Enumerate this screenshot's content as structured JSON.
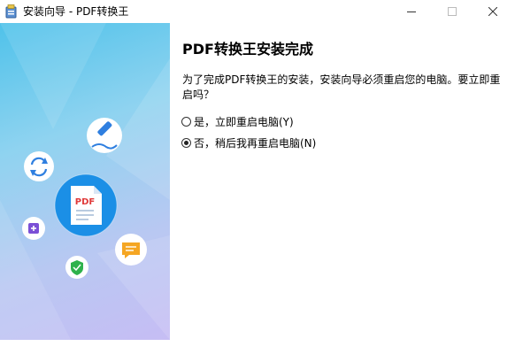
{
  "titlebar": {
    "title": "安装向导 - PDF转换王"
  },
  "content": {
    "heading": "PDF转换王安装完成",
    "message": "为了完成PDF转换王的安装，安装向导必须重启您的电脑。要立即重启吗？",
    "options": [
      {
        "label": "是，立即重启电脑(Y)",
        "selected": false
      },
      {
        "label": "否，稍后我再重启电脑(N)",
        "selected": true
      }
    ]
  },
  "banner": {
    "center_badge_text": "PDF",
    "icons": [
      "pen-icon",
      "sync-icon",
      "pdf-document-icon",
      "plus-icon",
      "shield-icon",
      "message-icon"
    ]
  },
  "colors": {
    "accent_blue": "#1b8fe6",
    "banner_top": "#4fc2ea",
    "banner_bottom": "#c6bdf4",
    "pdf_red": "#e03a3a",
    "message_orange": "#f5a623",
    "shield_green": "#2fb24c",
    "plus_purple": "#7b4fd6"
  }
}
